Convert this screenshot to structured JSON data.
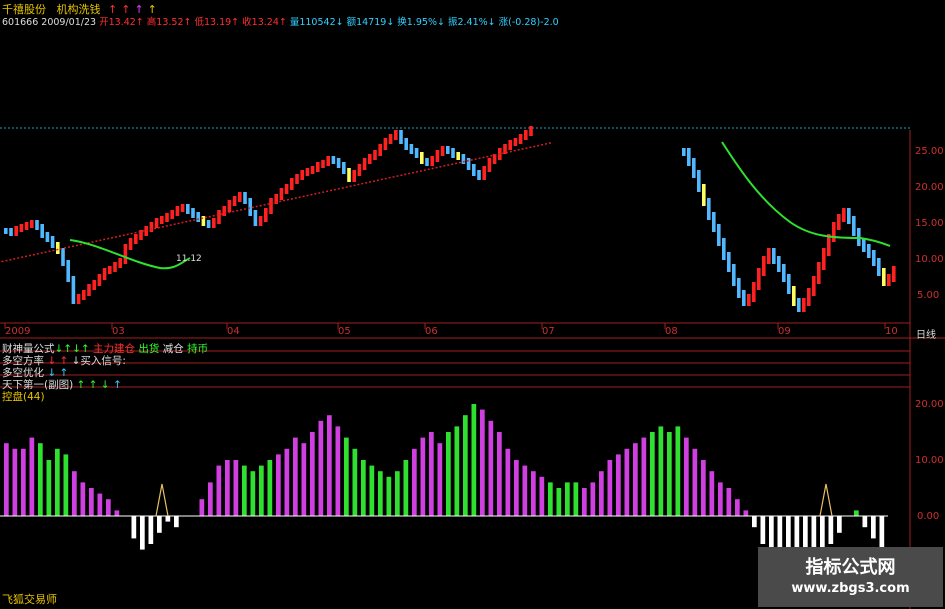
{
  "header": {
    "stock_name": "千禧股份",
    "formula_name": "机构洗钱",
    "arrows": [
      "↑",
      "↑",
      "↑",
      "↑"
    ],
    "code": "601666",
    "date": "2009/01/23",
    "fields": [
      {
        "k": "开",
        "v": "13.42",
        "dir": "up"
      },
      {
        "k": "高",
        "v": "13.52",
        "dir": "up"
      },
      {
        "k": "低",
        "v": "13.19",
        "dir": "up"
      },
      {
        "k": "收",
        "v": "13.24",
        "dir": "up"
      },
      {
        "k": "量",
        "v": "110542",
        "dir": "dn"
      },
      {
        "k": "额",
        "v": "14719",
        "dir": "dn"
      },
      {
        "k": "换",
        "v": "1.95%",
        "dir": "dn"
      },
      {
        "k": "振",
        "v": "2.41%",
        "dir": "dn"
      }
    ],
    "change": "涨(-0.28)-2.0"
  },
  "price_axis": [
    "25.00",
    "20.00",
    "15.00",
    "10.00",
    "5.00"
  ],
  "date_axis": {
    "labels": [
      "2009",
      "03",
      "04",
      "05",
      "06",
      "07",
      "08",
      "09",
      "10"
    ],
    "unit": "日线"
  },
  "annotation_low": "11.12",
  "indicators": [
    {
      "name": "财神量公式",
      "parts": [
        {
          "t": "↓↑↓↑",
          "c": "g"
        },
        {
          "t": " 主力建仓",
          "c": "r"
        },
        {
          "t": " 出货",
          "c": "g"
        },
        {
          "t": " 减仓",
          "c": "w"
        },
        {
          "t": " 持币",
          "c": "g"
        }
      ]
    },
    {
      "name": "多空方率",
      "parts": [
        {
          "t": " ↓ ↑",
          "c": "r"
        },
        {
          "t": "  ↓买入信号:",
          "c": "w"
        }
      ]
    },
    {
      "name": "多空优化",
      "parts": [
        {
          "t": " ↓ ↑",
          "c": "c"
        }
      ]
    },
    {
      "name": "天下第一(副图)",
      "parts": [
        {
          "t": " ↑ ↑ ↓",
          "c": "g"
        },
        {
          "t": "     ↑",
          "c": "c"
        }
      ]
    }
  ],
  "lower_panel": {
    "title": "控盘(44)",
    "axis": [
      "20.00",
      "10.00",
      "0.00"
    ]
  },
  "watermark": {
    "title": "指标公式网",
    "url": "www.zbgs3.com"
  },
  "footer": "飞狐交易师",
  "chart_data": {
    "type": "bar",
    "title": "控盘(44)",
    "ylim": [
      -12,
      22
    ],
    "values": [
      13,
      12,
      12,
      14,
      13,
      10,
      12,
      11,
      8,
      6,
      5,
      4,
      3,
      1,
      0,
      -4,
      -6,
      -5,
      -3,
      -1,
      -2,
      0,
      0,
      3,
      6,
      9,
      10,
      10,
      9,
      8,
      9,
      10,
      11,
      12,
      14,
      13,
      15,
      17,
      18,
      16,
      14,
      12,
      10,
      9,
      8,
      7,
      8,
      10,
      12,
      14,
      15,
      13,
      15,
      16,
      18,
      20,
      19,
      17,
      15,
      12,
      10,
      9,
      8,
      7,
      6,
      5,
      6,
      6,
      5,
      6,
      8,
      10,
      11,
      12,
      13,
      14,
      15,
      16,
      15,
      16,
      14,
      12,
      10,
      8,
      6,
      5,
      3,
      1,
      -2,
      -5,
      -8,
      -10,
      -12,
      -10,
      -8,
      -7,
      -6,
      -5,
      -3,
      0,
      1,
      -2,
      -4,
      -6
    ],
    "upper_price_note": "candles shown"
  }
}
